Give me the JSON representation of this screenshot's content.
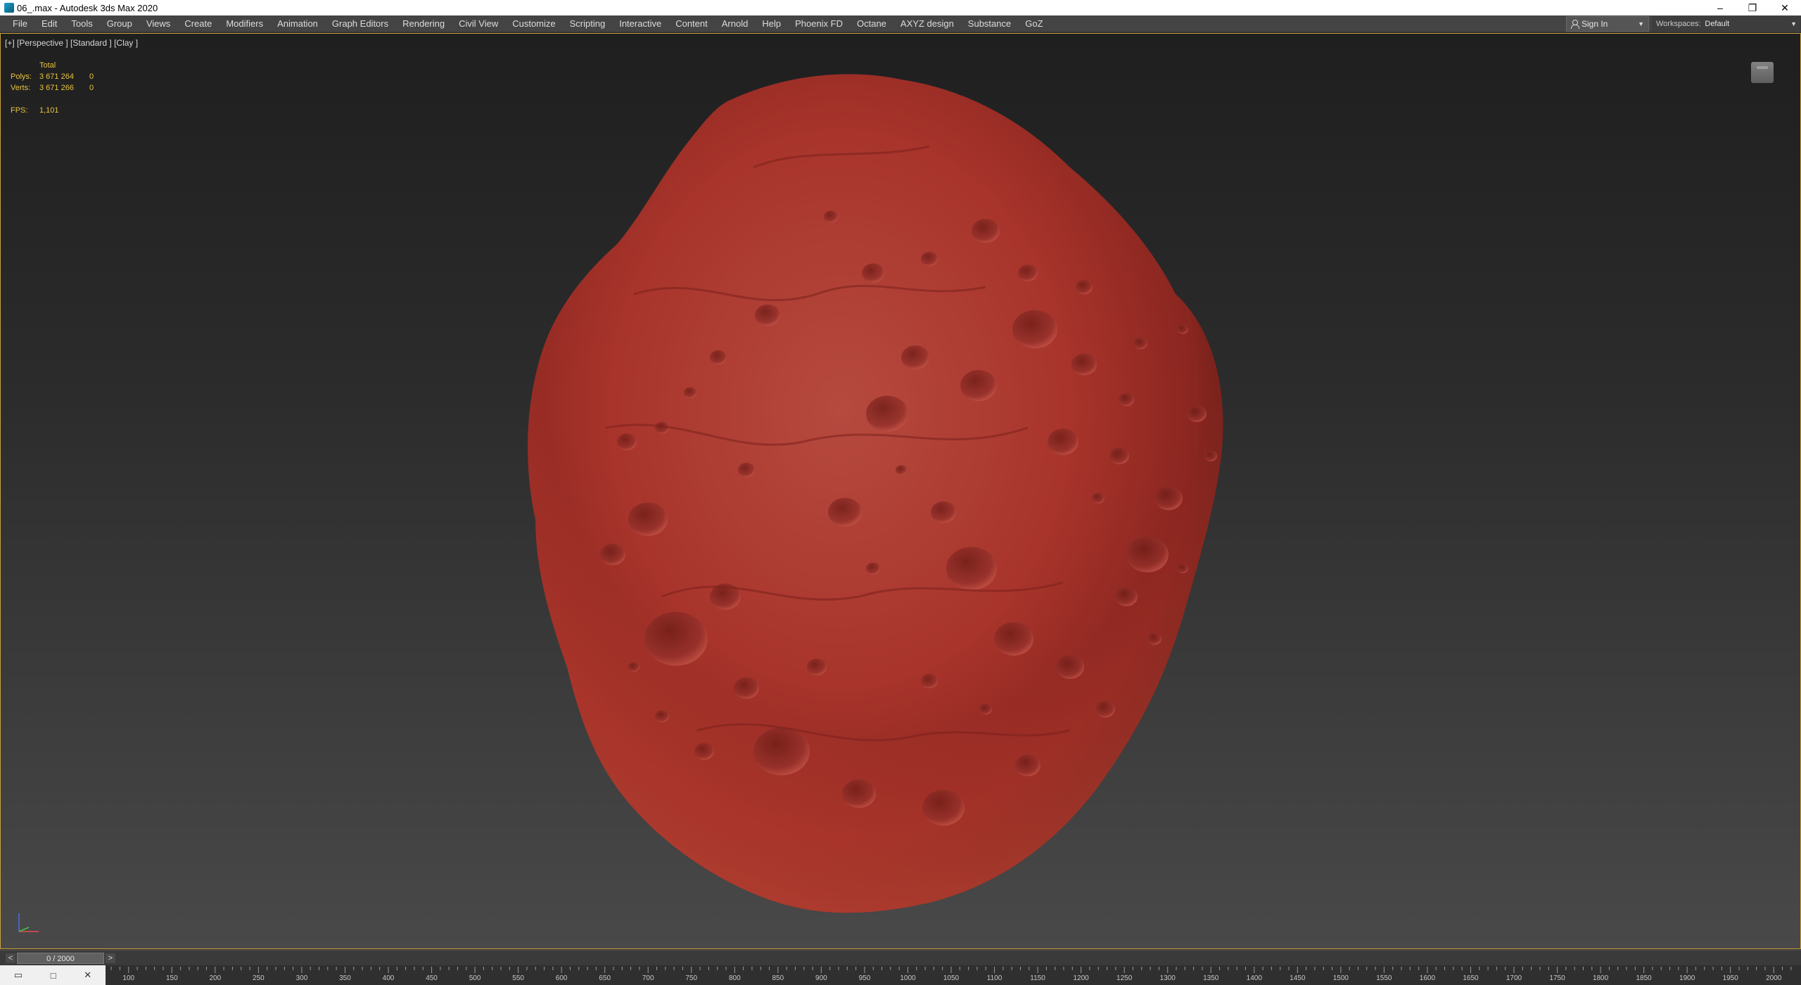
{
  "window": {
    "title": "06_.max - Autodesk 3ds Max 2020",
    "controls": [
      "–",
      "❐",
      "✕"
    ]
  },
  "menu": [
    "File",
    "Edit",
    "Tools",
    "Group",
    "Views",
    "Create",
    "Modifiers",
    "Animation",
    "Graph Editors",
    "Rendering",
    "Civil View",
    "Customize",
    "Scripting",
    "Interactive",
    "Content",
    "Arnold",
    "Help",
    "Phoenix FD",
    "Octane",
    "AXYZ design",
    "Substance",
    "GoZ"
  ],
  "account": {
    "sign_in": "Sign In",
    "workspaces_label": "Workspaces:",
    "workspace": "Default"
  },
  "viewport": {
    "label": "[+] [Perspective ] [Standard ] [Clay ]",
    "stats": {
      "header": "Total",
      "polys_label": "Polys:",
      "polys_total": "3 671 264",
      "polys_sel": "0",
      "verts_label": "Verts:",
      "verts_total": "3 671 266",
      "verts_sel": "0",
      "fps_label": "FPS:",
      "fps_value": "1,101"
    },
    "object": "asteroid-mesh"
  },
  "timeslider": {
    "position": "0 / 2000",
    "prev": "<",
    "next": ">"
  },
  "trackbar": {
    "ticks": [
      "100",
      "150",
      "200",
      "250",
      "300",
      "350",
      "400",
      "450",
      "500",
      "550",
      "600",
      "650",
      "700",
      "750",
      "800",
      "850",
      "900",
      "950",
      "1000",
      "1050",
      "1100",
      "1150",
      "1200",
      "1250",
      "1300",
      "1350",
      "1400",
      "1450",
      "1500",
      "1550",
      "1600",
      "1650",
      "1700",
      "1750",
      "1800",
      "1850",
      "1900",
      "1950",
      "2000"
    ]
  },
  "colors": {
    "accent": "#c8a040",
    "stats": "#e8c341",
    "asteroid": "#b8352d"
  },
  "icons": [
    "app-icon",
    "user-icon",
    "viewcube-icon",
    "axis-tripod-icon"
  ]
}
